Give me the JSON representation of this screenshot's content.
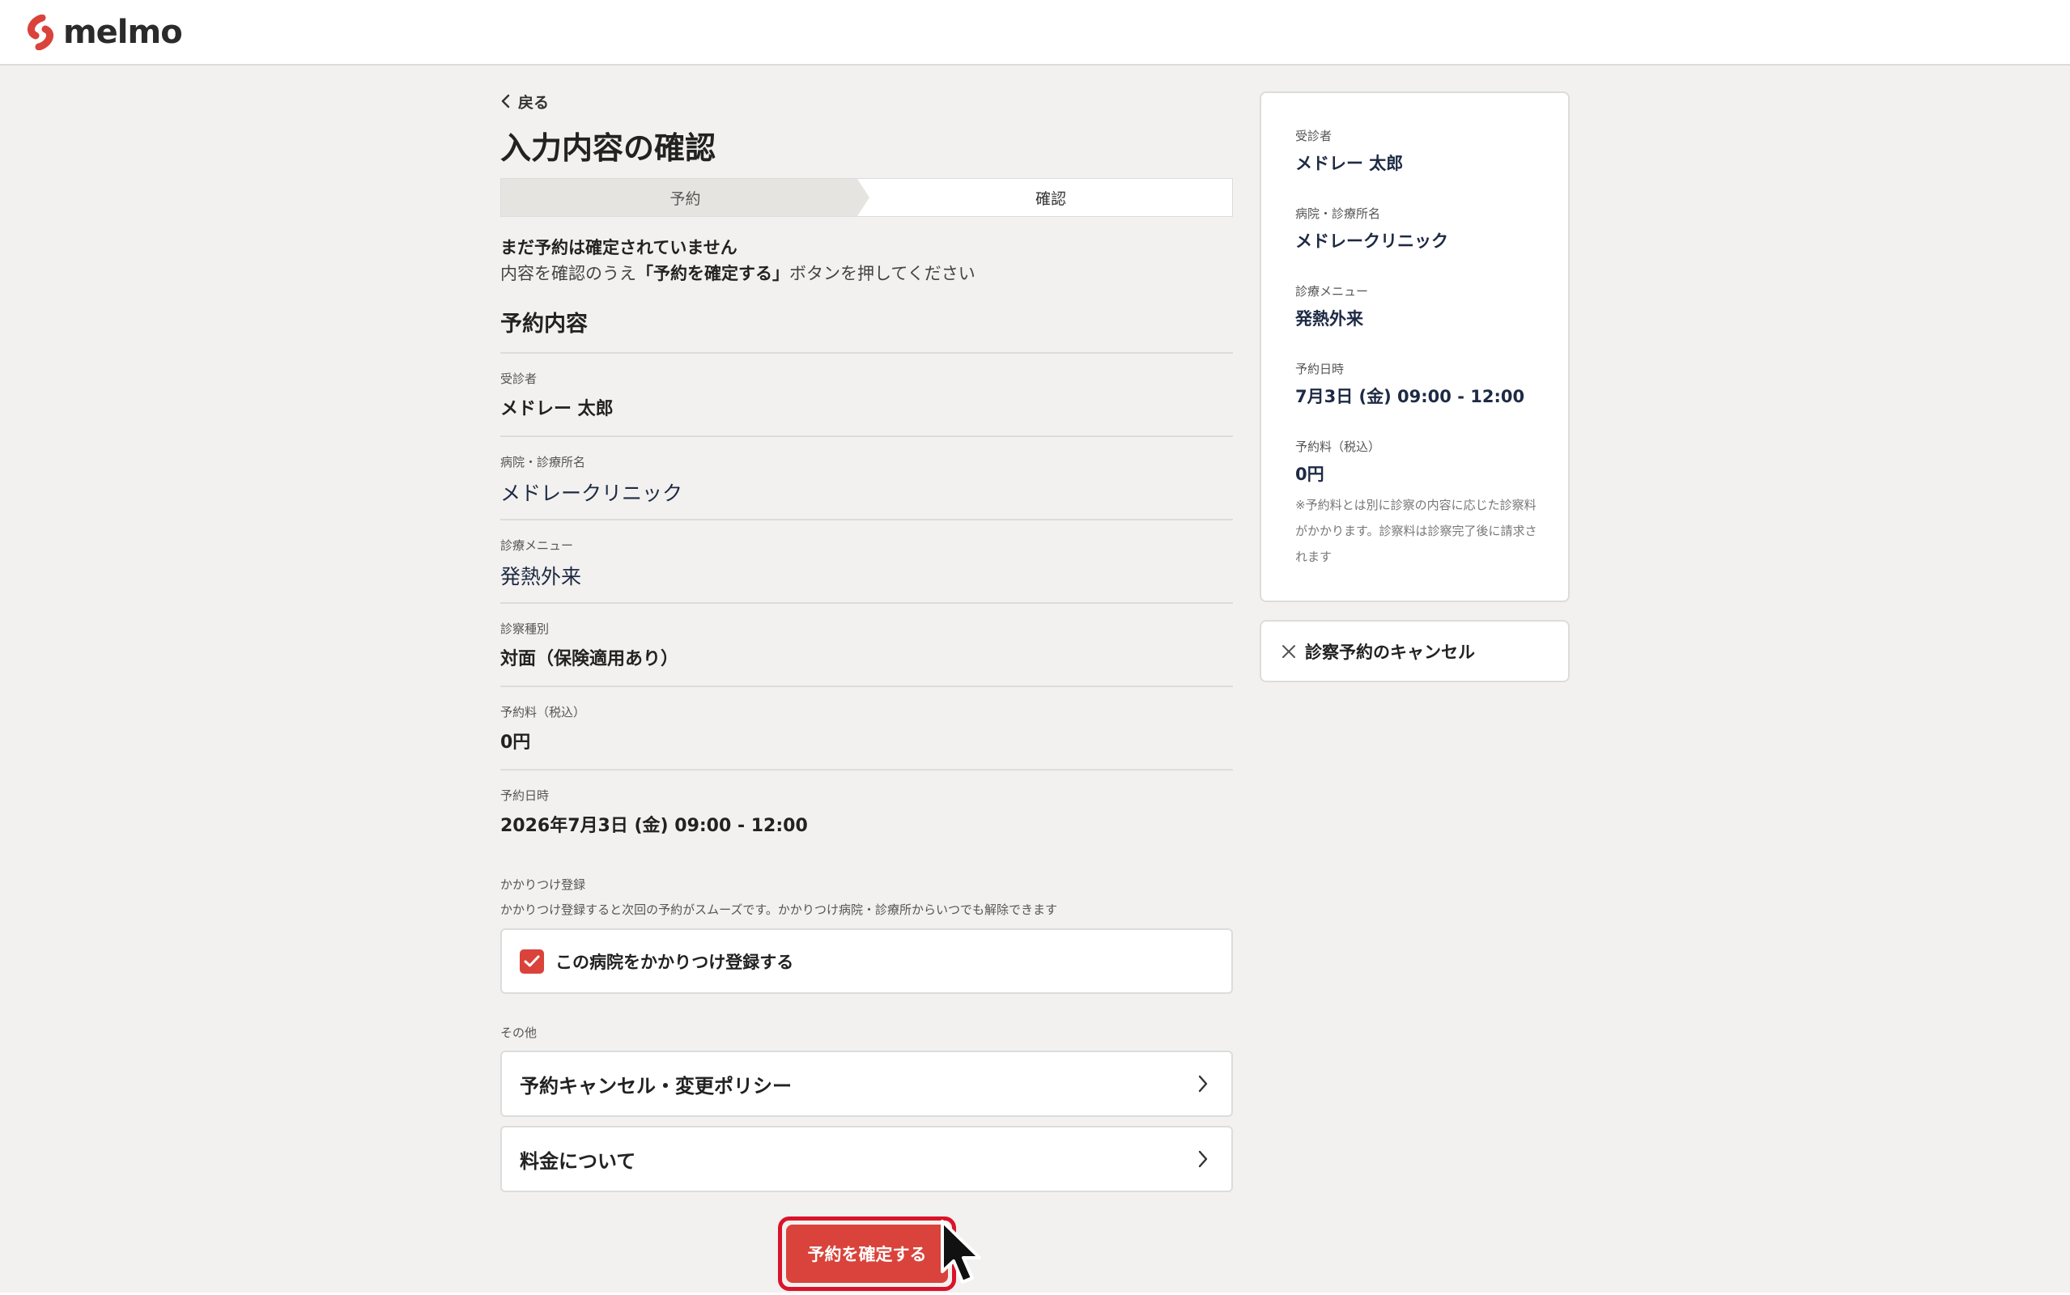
{
  "header": {
    "logo_text": "melmo"
  },
  "nav": {
    "back_label": "戻る"
  },
  "page": {
    "title": "入力内容の確認"
  },
  "stepper": {
    "step1": "予約",
    "step2": "確認"
  },
  "notice": {
    "line1": "まだ予約は確定されていません",
    "line2_prefix": "内容を確認のうえ",
    "line2_bold": "「予約を確定する」",
    "line2_suffix": "ボタンを押してください"
  },
  "reservation": {
    "section_title": "予約内容",
    "rows": [
      {
        "label": "受診者",
        "value": "メドレー 太郎"
      },
      {
        "label": "病院・診療所名",
        "value": "メドレークリニック"
      },
      {
        "label": "診療メニュー",
        "value": "発熱外来"
      },
      {
        "label": "診察種別",
        "value": "対面（保険適用あり）"
      },
      {
        "label": "予約料（税込）",
        "value": "0円"
      },
      {
        "label": "予約日時",
        "value": "2026年7月3日 (金) 09:00 - 12:00"
      }
    ]
  },
  "favorite": {
    "label": "かかりつけ登録",
    "description": "かかりつけ登録すると次回の予約がスムーズです。かかりつけ病院・診療所からいつでも解除できます",
    "checkbox_label": "この病院をかかりつけ登録する",
    "checked": true
  },
  "other": {
    "label": "その他",
    "links": [
      {
        "label": "予約キャンセル・変更ポリシー"
      },
      {
        "label": "料金について"
      }
    ]
  },
  "actions": {
    "confirm_label": "予約を確定する"
  },
  "summary": {
    "items": [
      {
        "label": "受診者",
        "value": "メドレー 太郎"
      },
      {
        "label": "病院・診療所名",
        "value": "メドレークリニック"
      },
      {
        "label": "診療メニュー",
        "value": "発熱外来"
      },
      {
        "label": "予約日時",
        "value": "7月3日 (金) 09:00 - 12:00"
      },
      {
        "label": "予約料（税込）",
        "value": "0円"
      }
    ],
    "note": "※予約料とは別に診察の内容に応じた診察料がかかります。診察料は診察完了後に請求されます",
    "cancel_label": "診察予約のキャンセル"
  },
  "colors": {
    "accent": "#d9433b",
    "highlight": "#d9142a",
    "text": "#222222",
    "background": "#f2f1ef"
  }
}
